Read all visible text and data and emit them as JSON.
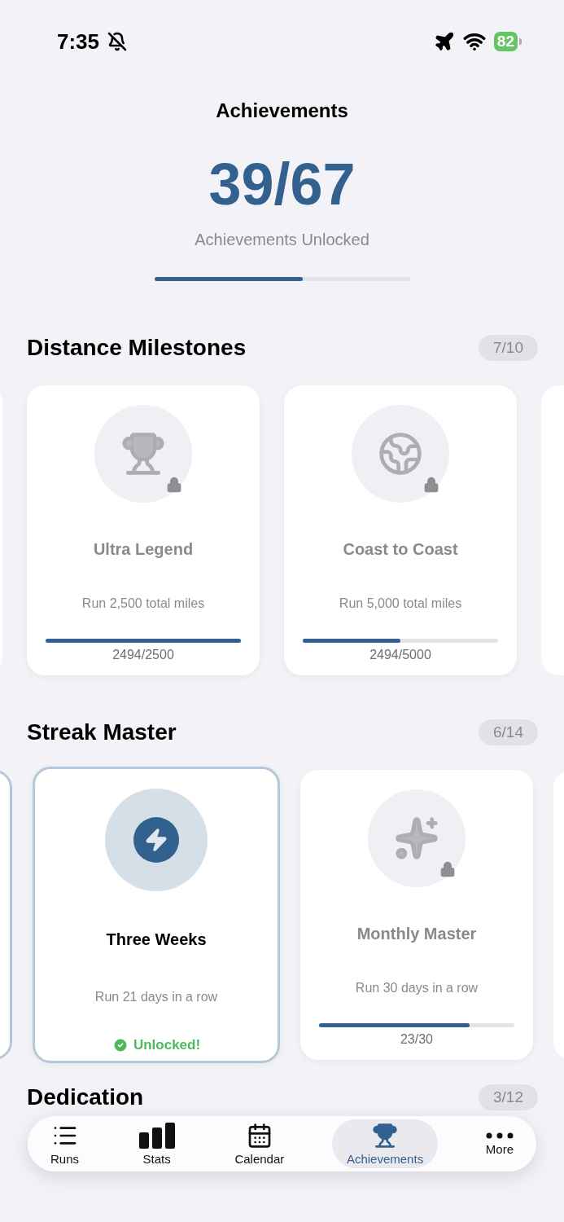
{
  "status_bar": {
    "time": "7:35",
    "battery": "82"
  },
  "header": {
    "title": "Achievements",
    "count": "39/67",
    "subtitle": "Achievements Unlocked",
    "level": 0.58
  },
  "sections": [
    {
      "title": "Distance Milestones",
      "badge": "7/10",
      "cards": [
        {
          "name": "Ultra Legend",
          "description": "Run 2,500 total miles",
          "unlocked": false,
          "progress": "2494/2500",
          "level": 0.998
        },
        {
          "name": "Coast to Coast",
          "description": "Run 5,000 total miles",
          "unlocked": false,
          "progress": "2494/5000",
          "level": 0.5
        }
      ]
    },
    {
      "title": "Streak Master",
      "badge": "6/14",
      "cards": [
        {
          "name": "Three Weeks",
          "description": "Run 21 days in a row",
          "unlocked": true,
          "status": "Unlocked!"
        },
        {
          "name": "Monthly Master",
          "description": "Run 30 days in a row",
          "unlocked": false,
          "progress": "23/30",
          "level": 0.77
        }
      ]
    },
    {
      "title": "Dedication",
      "badge": "3/12"
    }
  ],
  "tab_bar": [
    {
      "label": "Runs",
      "selected": false
    },
    {
      "label": "Stats",
      "selected": false
    },
    {
      "label": "Calendar",
      "selected": false
    },
    {
      "label": "Achievements",
      "selected": true
    },
    {
      "label": "More",
      "selected": false
    }
  ]
}
